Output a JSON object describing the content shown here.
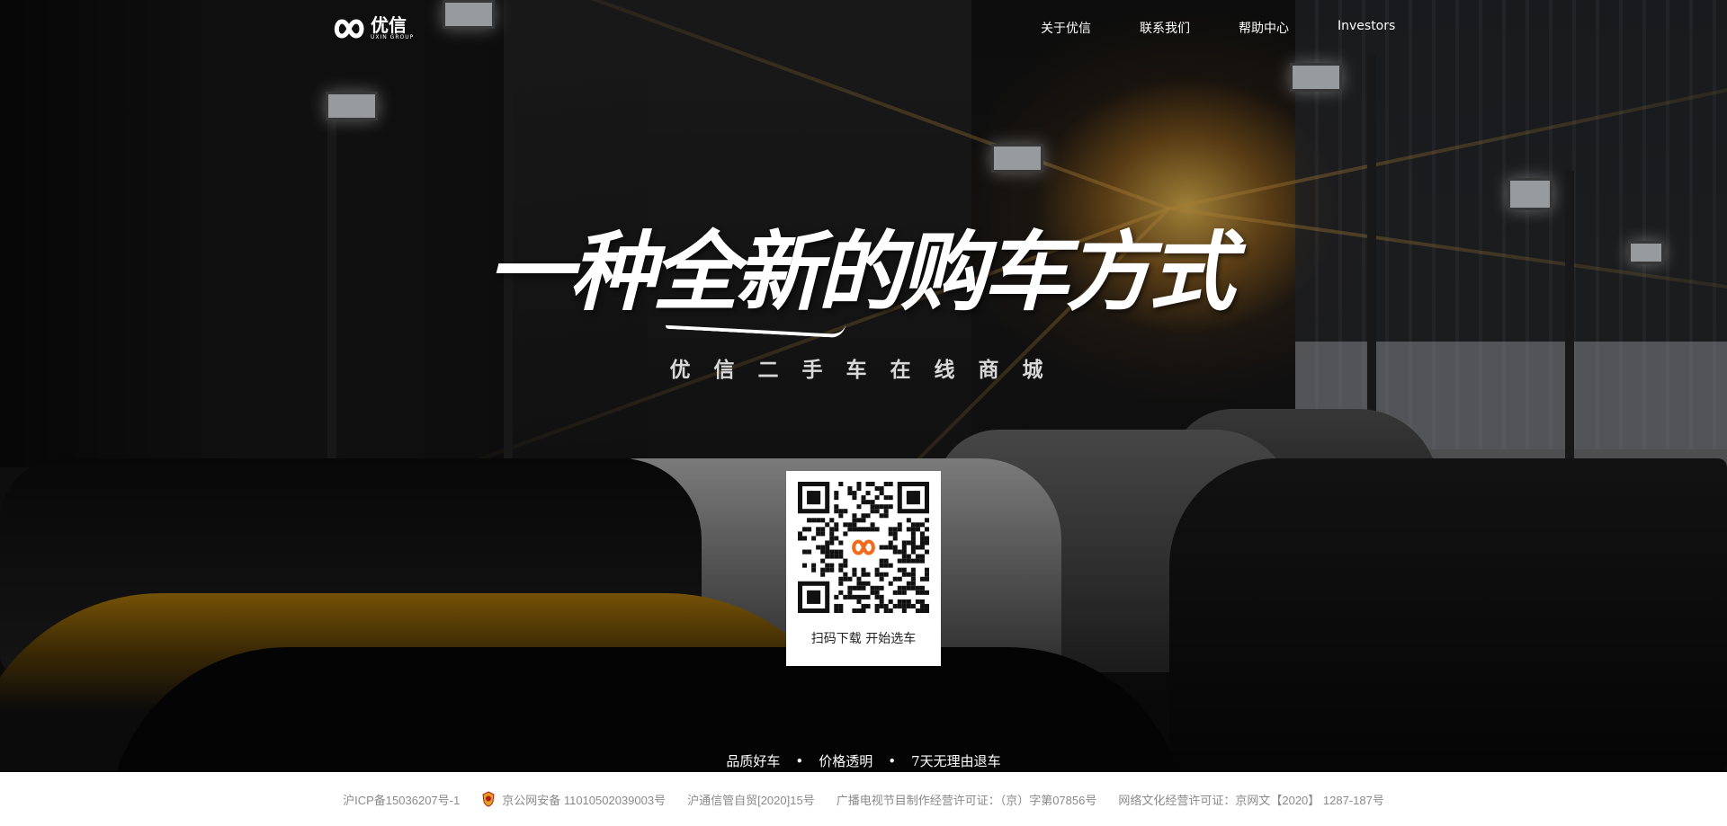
{
  "brand": {
    "name": "优信",
    "sub": "UXIN GROUP"
  },
  "nav": {
    "items": [
      {
        "label": "关于优信"
      },
      {
        "label": "联系我们"
      },
      {
        "label": "帮助中心"
      },
      {
        "label": "Investors"
      }
    ]
  },
  "hero": {
    "slogan": "一种全新的购车方式",
    "subtitle": "优信二手车在线商城"
  },
  "qr": {
    "caption": "扫码下载  开始选车"
  },
  "features": [
    "品质好车",
    "价格透明",
    "7天无理由退车"
  ],
  "footer": {
    "icp": "沪ICP备15036207号-1",
    "police": "京公网安备 11010502039003号",
    "telecom": "沪通信管自贸[2020]15号",
    "broadcast": "广播电视节目制作经营许可证：（京）字第07856号",
    "culture": "网络文化经营许可证：京网文【2020】 1287-187号"
  },
  "colors": {
    "accent": "#f26b1d",
    "footer_text": "#8a8a8a",
    "sun": "#ffcd5a"
  },
  "icons": {
    "logo": "uxin-infinity-logo",
    "police_badge": "police-badge-icon"
  }
}
